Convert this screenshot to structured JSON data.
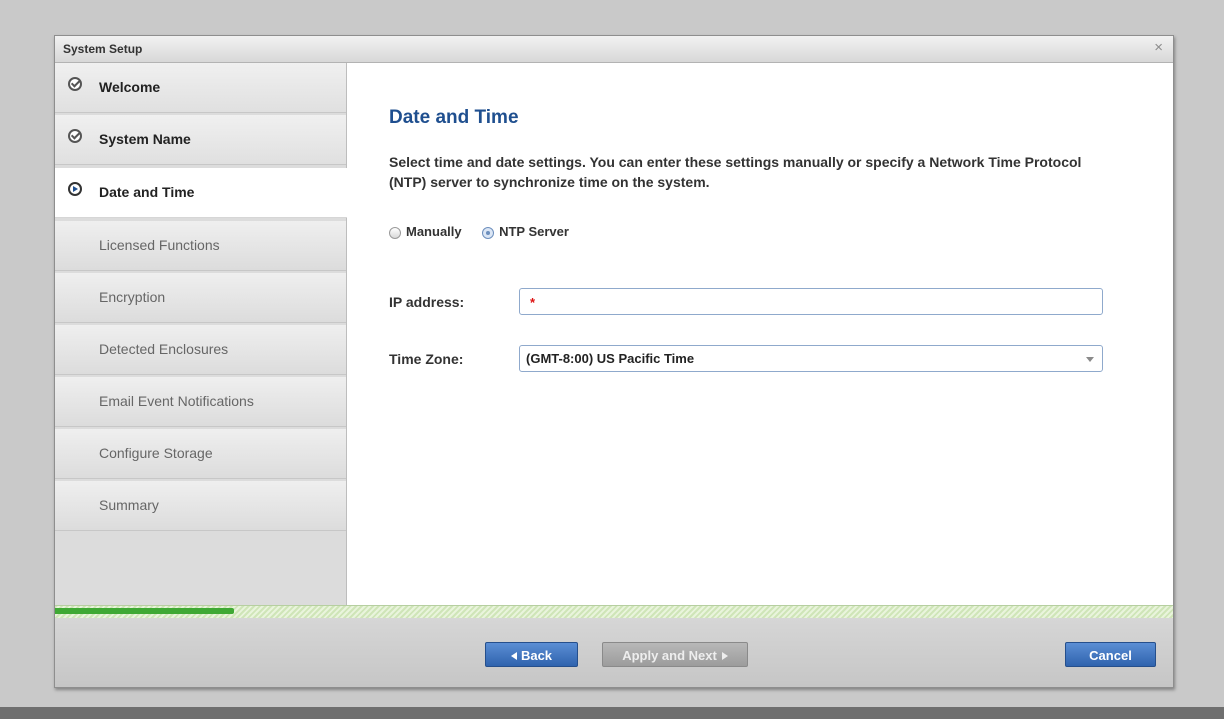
{
  "window": {
    "title": "System Setup",
    "close_glyph": "×"
  },
  "steps": [
    {
      "label": "Welcome",
      "state": "completed",
      "icon": "check-icon"
    },
    {
      "label": "System Name",
      "state": "completed",
      "icon": "check-icon"
    },
    {
      "label": "Date and Time",
      "state": "current",
      "icon": "arrow-right-icon"
    },
    {
      "label": "Licensed Functions",
      "state": "pending"
    },
    {
      "label": "Encryption",
      "state": "pending"
    },
    {
      "label": "Detected Enclosures",
      "state": "pending"
    },
    {
      "label": "Email Event Notifications",
      "state": "pending"
    },
    {
      "label": "Configure Storage",
      "state": "pending"
    },
    {
      "label": "Summary",
      "state": "pending"
    }
  ],
  "main": {
    "heading": "Date and Time",
    "description": "Select time and date settings. You can enter these settings manually or specify a Network Time Protocol (NTP) server to synchronize time on the system.",
    "mode_options": [
      {
        "label": "Manually",
        "selected": false
      },
      {
        "label": "NTP Server",
        "selected": true
      }
    ],
    "ip_address": {
      "label": "IP address:",
      "value": "",
      "required_mark": "*"
    },
    "time_zone": {
      "label": "Time Zone:",
      "selected": "(GMT-8:00) US Pacific Time"
    }
  },
  "progress": {
    "percent": 16
  },
  "footer": {
    "back_label": "Back",
    "apply_label": "Apply and Next",
    "cancel_label": "Cancel"
  },
  "colors": {
    "accent": "#1f4f8f",
    "primary_button": "#3a70bd",
    "progress_fill": "#3fa934",
    "required": "#dd1111"
  }
}
